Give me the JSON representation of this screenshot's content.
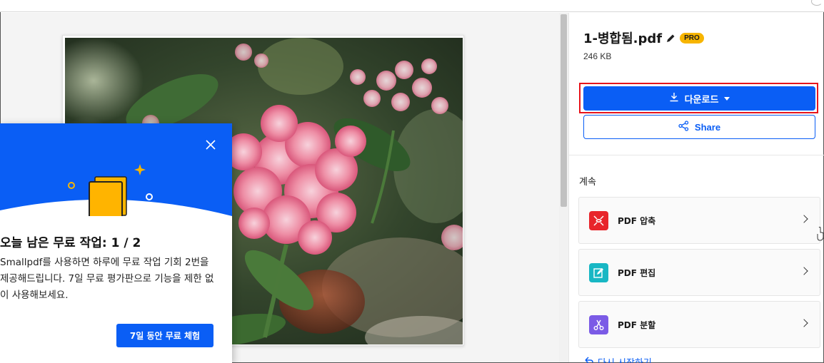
{
  "sidebar": {
    "file_name": "1-병합됨.pdf",
    "pro_badge": "PRO",
    "file_size": "246 KB",
    "download_label": "다운로드",
    "share_label": "Share",
    "continue_label": "계속",
    "tools": [
      {
        "label": "PDF 압축",
        "icon": "compress-icon",
        "color": "#e8252b"
      },
      {
        "label": "PDF 편집",
        "icon": "edit-icon",
        "color": "#18b7c4"
      },
      {
        "label": "PDF 분할",
        "icon": "scissors-icon",
        "color": "#7b5be6"
      }
    ],
    "restart_label": "다시 시작하기"
  },
  "popup": {
    "title": "오늘 남은 무료 작업: 1 / 2",
    "body": "Smallpdf를 사용하면 하루에 무료 작업 기회 2번을 제공해드립니다. 7일 무료 평가판으로 기능을 제한 없이 사용해보세요.",
    "cta_label": "7일 동안 무료 체험"
  },
  "colors": {
    "accent": "#0a5ef5",
    "highlight": "#e8141b",
    "pro": "#f7b500"
  }
}
